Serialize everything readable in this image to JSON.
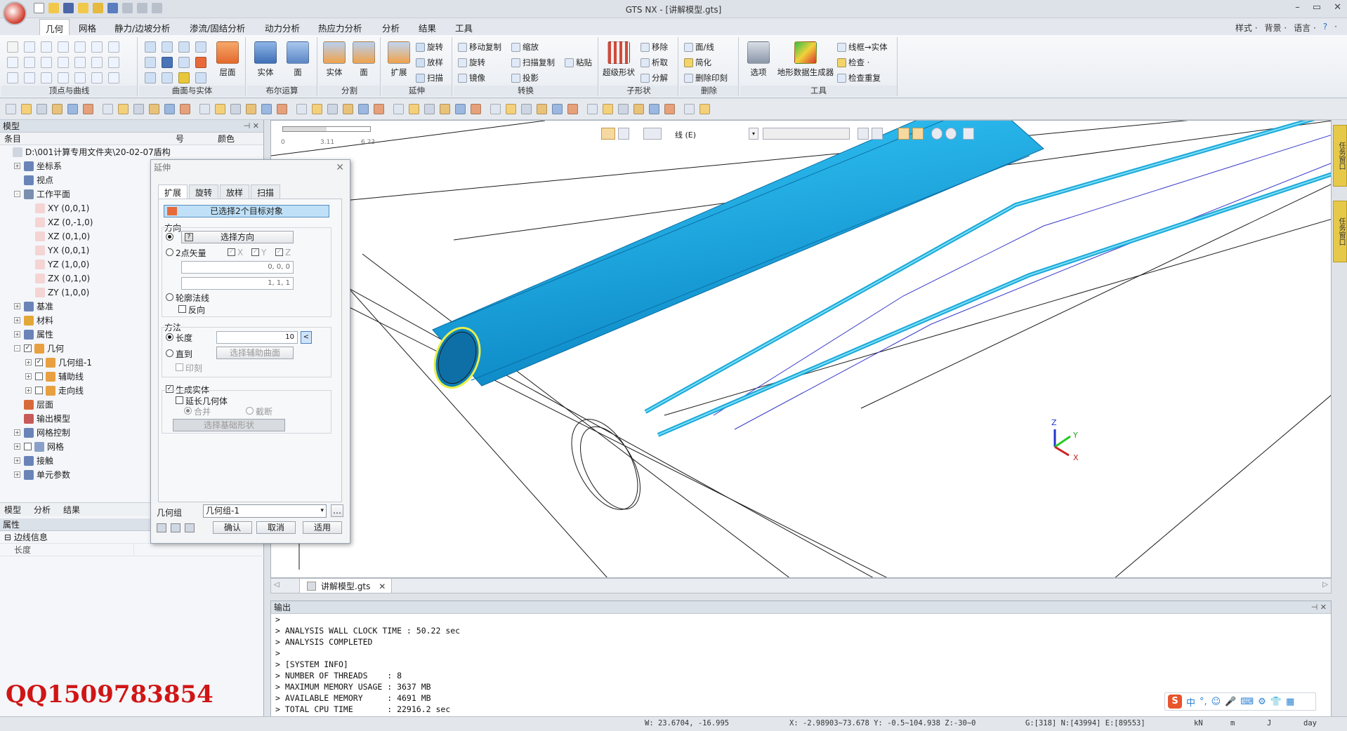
{
  "window": {
    "title": "GTS NX - [讲解模型.gts]"
  },
  "menu_tabs": [
    "几何",
    "网格",
    "静力/边坡分析",
    "渗流/固结分析",
    "动力分析",
    "热应力分析",
    "分析",
    "结果",
    "工具"
  ],
  "active_tab": "几何",
  "right_menu": [
    "样式 ·",
    "背景 ·",
    "语言 ·",
    "?",
    "·"
  ],
  "ribbon": {
    "groups": [
      "顶点与曲线",
      "曲面与实体",
      "布尔运算",
      "分割",
      "延伸",
      "转换",
      "子形状",
      "删除",
      "工具"
    ],
    "buttons": {
      "layer": "层面",
      "solid": "实体",
      "face": "面",
      "split_solid": "实体",
      "split_face": "面",
      "extend": "扩展",
      "rotate": "旋转",
      "loft": "放样",
      "sweep": "扫描",
      "move_copy": "移动复制",
      "scale": "缩放",
      "rotate2": "旋转",
      "sweep_copy": "扫描复制",
      "paste": "粘贴",
      "mirror": "镜像",
      "project": "投影",
      "super_shape": "超级形状",
      "remove": "移除",
      "extract": "析取",
      "decompose": "分解",
      "face_line": "面/线",
      "simplify": "简化",
      "delete_imprint": "删除印刻",
      "options": "选项",
      "terrain": "地形数据生成器",
      "wire_solid": "线框→实体",
      "check": "检查 ·",
      "check_dup": "检查重复"
    }
  },
  "model_panel": {
    "title": "模型",
    "columns": [
      "条目",
      "号",
      "颜色"
    ],
    "tree": [
      {
        "label": "D:\\001计算专用文件夹\\20-02-07盾构",
        "level": 0,
        "icon": "file-icon"
      },
      {
        "label": "坐标系",
        "level": 1,
        "icon": "axis-icon",
        "expand": "+"
      },
      {
        "label": "视点",
        "level": 1,
        "icon": "viewpoint-icon"
      },
      {
        "label": "工作平面",
        "level": 1,
        "icon": "grid-icon",
        "expand": "-"
      },
      {
        "label": "XY (0,0,1)",
        "level": 2,
        "icon": "plane-icon"
      },
      {
        "label": "XZ (0,-1,0)",
        "level": 2,
        "icon": "plane-icon"
      },
      {
        "label": "XZ (0,1,0)",
        "level": 2,
        "icon": "plane-icon"
      },
      {
        "label": "YX (0,0,1)",
        "level": 2,
        "icon": "plane-icon"
      },
      {
        "label": "YZ (1,0,0)",
        "level": 2,
        "icon": "plane-icon"
      },
      {
        "label": "ZX (0,1,0)",
        "level": 2,
        "icon": "plane-icon"
      },
      {
        "label": "ZY (1,0,0)",
        "level": 2,
        "icon": "plane-icon"
      },
      {
        "label": "基准",
        "level": 1,
        "icon": "datum-icon",
        "expand": "+"
      },
      {
        "label": "材料",
        "level": 1,
        "icon": "material-icon",
        "expand": "+"
      },
      {
        "label": "属性",
        "level": 1,
        "icon": "property-icon",
        "expand": "+"
      },
      {
        "label": "几何",
        "level": 1,
        "icon": "geometry-icon",
        "expand": "-",
        "check": "✓"
      },
      {
        "label": "几何组-1",
        "level": 2,
        "icon": "box-icon",
        "expand": "+",
        "check": "✓"
      },
      {
        "label": "辅助线",
        "level": 2,
        "icon": "box-icon",
        "expand": "+",
        "check": ""
      },
      {
        "label": "走向线",
        "level": 2,
        "icon": "box-icon",
        "expand": "+",
        "check": ""
      },
      {
        "label": "层面",
        "level": 1,
        "icon": "layer-icon"
      },
      {
        "label": "输出模型",
        "level": 1,
        "icon": "output-icon"
      },
      {
        "label": "网格控制",
        "level": 1,
        "icon": "mesh-control-icon",
        "expand": "+"
      },
      {
        "label": "网格",
        "level": 1,
        "icon": "mesh-icon",
        "expand": "+",
        "check": ""
      },
      {
        "label": "接触",
        "level": 1,
        "icon": "contact-icon",
        "expand": "+"
      },
      {
        "label": "单元参数",
        "level": 1,
        "icon": "element-icon",
        "expand": "+"
      }
    ],
    "bottom_tabs": [
      "模型",
      "分析",
      "结果"
    ],
    "properties_title": "属性",
    "properties": [
      {
        "group": "边线信息",
        "key": "长度"
      }
    ]
  },
  "dialog": {
    "title": "延伸",
    "tabs": [
      "扩展",
      "旋转",
      "放样",
      "扫描"
    ],
    "active_tab": "扩展",
    "selected_objects": "已选择2个目标对象",
    "direction_label": "方向",
    "select_direction": "选择方向",
    "two_point_vector": "2点矢量",
    "axis_x": "X",
    "axis_y": "Y",
    "axis_z": "Z",
    "vector_start": "0, 0, 0",
    "vector_end": "1, 1, 1",
    "contour_normal": "轮廓法线",
    "reverse": "反向",
    "method_label": "方法",
    "length_label": "长度",
    "length_value": "10",
    "until_label": "直到",
    "select_aux_surface": "选择辅助曲面",
    "imprint": "印刻",
    "generate_solid": "生成实体",
    "extend_geometry": "延长几何体",
    "merge": "合并",
    "cut": "截断",
    "select_base_shape": "选择基础形状",
    "geometry_group_label": "几何组",
    "geometry_group_value": "几何组-1",
    "ok": "确认",
    "cancel": "取消",
    "apply": "适用"
  },
  "viewport": {
    "ruler_ticks": [
      "0",
      "3.11",
      "6.23"
    ],
    "snap_label": "线 (E)",
    "axis_labels": {
      "z": "Z",
      "y": "Y",
      "x": "X"
    },
    "pipe_color": "#2ab8ea"
  },
  "file_tab": "讲解模型.gts",
  "output": {
    "title": "输出",
    "lines": [
      ">",
      "> ANALYSIS WALL CLOCK TIME : 50.22 sec",
      "> ANALYSIS COMPLETED",
      ">",
      "> [SYSTEM INFO]",
      "> NUMBER OF THREADS    : 8",
      "> MAXIMUM MEMORY USAGE : 3637 MB",
      "> AVAILABLE MEMORY     : 4691 MB",
      "> TOTAL CPU TIME       : 22916.2 sec"
    ]
  },
  "statusbar": {
    "coords": "W: 23.6704, -16.995",
    "xyz": "X: -2.98903~73.678  Y: -0.5~104.938  Z:-30~0",
    "counts": "G:[318]  N:[43994]  E:[89553]",
    "unit_force": "kN",
    "unit_length": "m",
    "unit_heat": "J",
    "unit_time": "day"
  },
  "watermark": "QQ1509783854",
  "side_tabs": [
    "任务窗口",
    "任务窗口"
  ],
  "ime": [
    "中",
    "°,",
    "☺",
    "🎤",
    "⌨",
    "⚙",
    "👕",
    "▦"
  ]
}
